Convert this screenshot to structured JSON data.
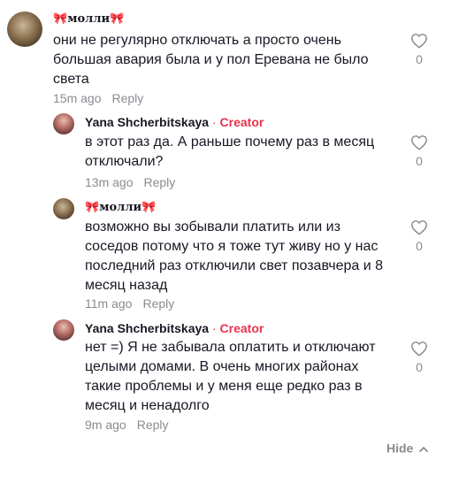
{
  "comments": [
    {
      "username": "молли",
      "is_creator": false,
      "text": "они не регулярно отключать а просто очень\nбольшая авария была и у пол Еревана не было\nсвета",
      "time": "15m ago",
      "reply": "Reply",
      "likes": "0"
    },
    {
      "username": "Yana Shcherbitskaya",
      "is_creator": true,
      "creator_label": "Creator",
      "text": "в этот раз да. А раньше почему раз в месяц\nотключали?",
      "time": "13m ago",
      "reply": "Reply",
      "likes": "0"
    },
    {
      "username": "молли",
      "is_creator": false,
      "text": "возможно вы зобывали платить или из\nсоседов потому что я тоже тут живу но у нас\nпоследний раз отключили свет позавчера и 8\nмесяц назад",
      "time": "11m ago",
      "reply": "Reply",
      "likes": "0"
    },
    {
      "username": "Yana Shcherbitskaya",
      "is_creator": true,
      "creator_label": "Creator",
      "text": "нет =) Я не забывала оплатить и отключают\nцелыми домами. В очень многих районах\nтакие проблемы и у меня еще редко раз в\nмесяц и ненадолго",
      "time": "9m ago",
      "reply": "Reply",
      "likes": "0"
    }
  ],
  "hide_label": "Hide",
  "separator": "·",
  "bow_glyph": "🎀",
  "colors": {
    "creator": "#e8334f",
    "muted": "#8a8b91",
    "text": "#161823"
  }
}
